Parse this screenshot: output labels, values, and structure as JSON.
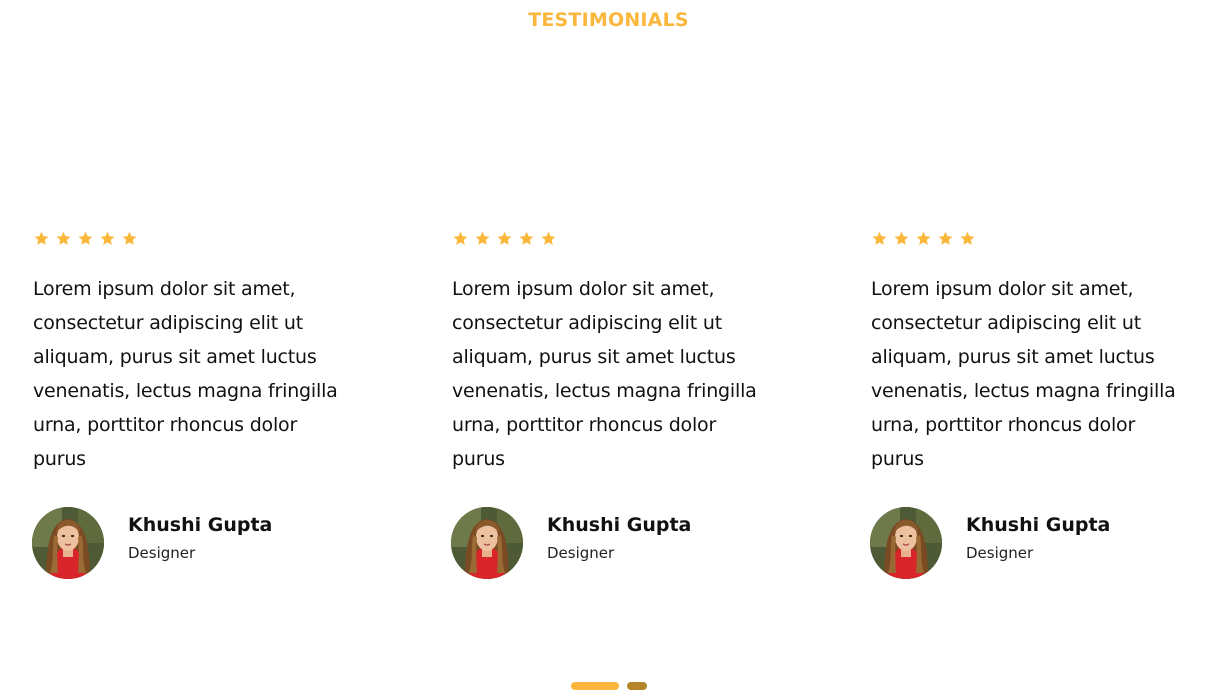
{
  "section": {
    "title": "TESTIMONIALS"
  },
  "colors": {
    "accent": "#FBB73C",
    "dot_active": "#FBB73C",
    "dot_inactive": "#B5852A"
  },
  "testimonials": [
    {
      "rating": 5,
      "rating_icon": "star-icon",
      "quote": "Lorem ipsum dolor sit amet, consectetur adipiscing elit ut aliquam, purus sit amet luctus venenatis, lectus magna fringilla urna, porttitor rhoncus dolor purus",
      "name": "Khushi Gupta",
      "role": "Designer"
    },
    {
      "rating": 5,
      "rating_icon": "star-icon",
      "quote": "Lorem ipsum dolor sit amet, consectetur adipiscing elit ut aliquam, purus sit amet luctus venenatis, lectus magna fringilla urna, porttitor rhoncus dolor purus",
      "name": "Khushi Gupta",
      "role": "Designer"
    },
    {
      "rating": 5,
      "rating_icon": "star-icon",
      "quote": "Lorem ipsum dolor sit amet, consectetur adipiscing elit ut aliquam, purus sit amet luctus venenatis, lectus magna fringilla urna, porttitor rhoncus dolor purus",
      "name": "Khushi Gupta",
      "role": "Designer"
    }
  ],
  "carousel": {
    "pages": 2,
    "active_page": 1
  }
}
